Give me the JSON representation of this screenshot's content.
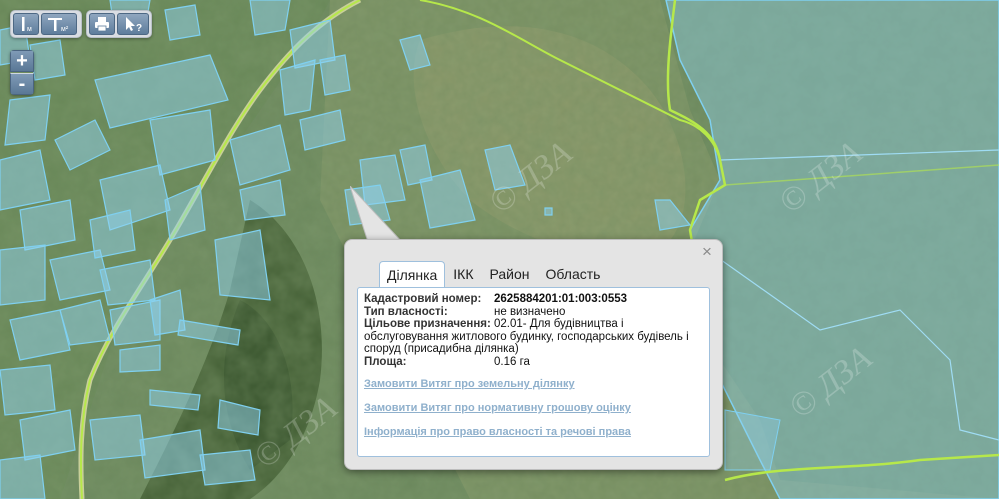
{
  "map": {
    "watermark": "© ДЗА",
    "colors": {
      "parcel_fill": "#8fd2ee",
      "parcel_stroke": "#7fd0f0",
      "boundary": "#b6e84a",
      "road": "#c8cf9a"
    }
  },
  "toolbar": {
    "buttons": [
      {
        "name": "measure-length-button",
        "icon": "ruler-m-icon",
        "sub": "м"
      },
      {
        "name": "measure-area-button",
        "icon": "ruler-m2-icon",
        "sub": "м²"
      },
      {
        "name": "print-button",
        "icon": "printer-icon"
      },
      {
        "name": "identify-button",
        "icon": "cursor-question-icon"
      }
    ]
  },
  "zoom": {
    "in_label": "+",
    "out_label": "-"
  },
  "popup": {
    "close_label": "×",
    "tabs": [
      "Ділянка",
      "ІКК",
      "Район",
      "Область"
    ],
    "active_tab": "Ділянка",
    "fields": [
      {
        "label": "Кадастровий номер:",
        "value": "2625884201:01:003:0553",
        "strong": true
      },
      {
        "label": "Тип власності:",
        "value": "не визначено"
      },
      {
        "label": "Цільове призначення:",
        "value": "02.01- Для будівництва і"
      }
    ],
    "purpose_continuation": "обслуговування житлового будинку, господарських будівель і споруд (присадибна ділянка)",
    "area": {
      "label": "Площа:",
      "value": "0.16 га"
    },
    "links": [
      "Замовити Витяг про земельну ділянку",
      "Замовити Витяг про нормативну грошову оцінку",
      "Інформація про право власності та речові права"
    ]
  }
}
